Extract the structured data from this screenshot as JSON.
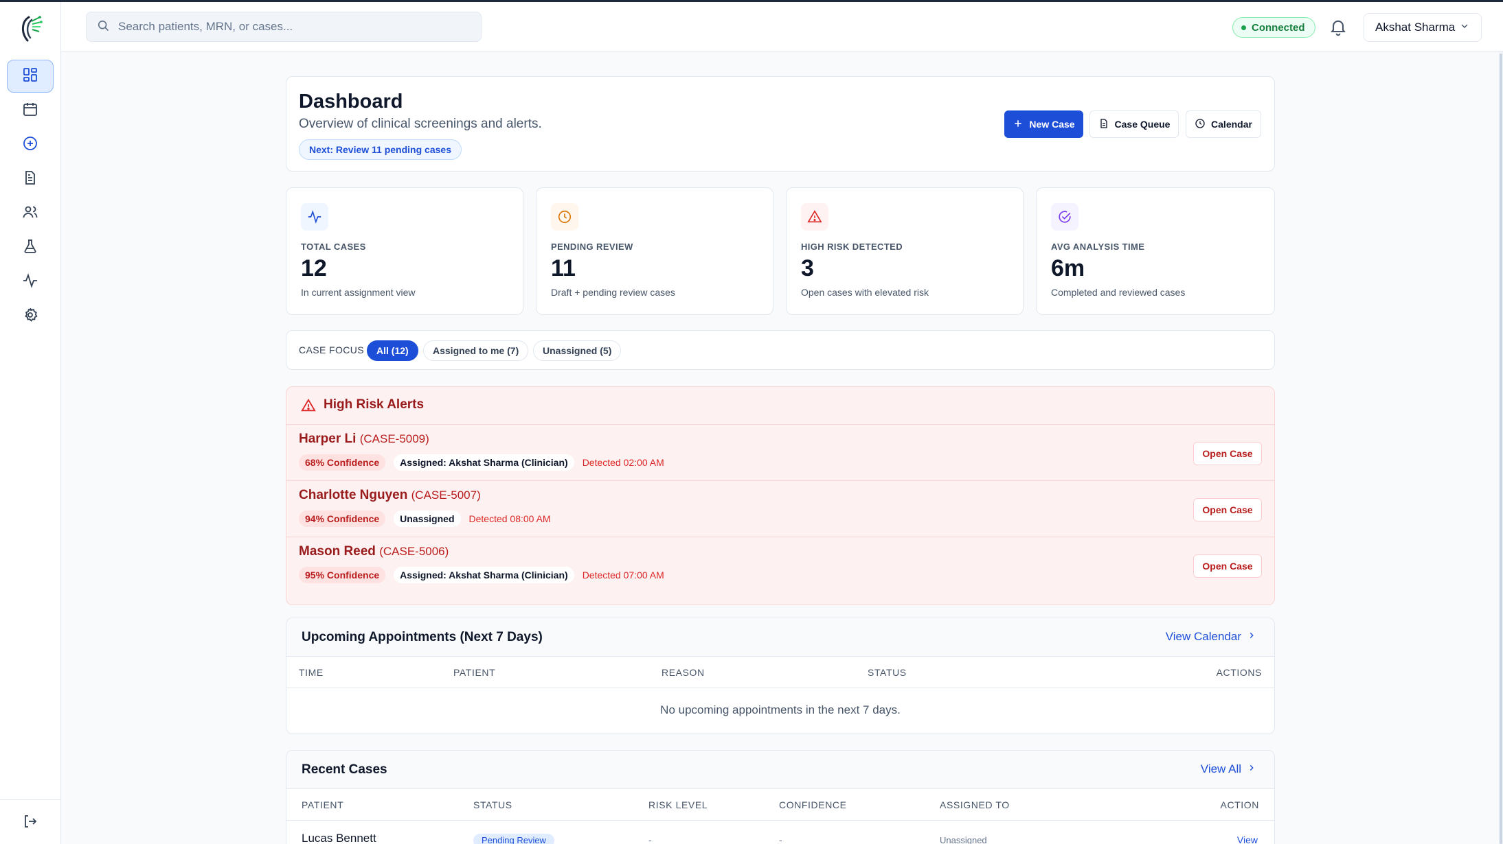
{
  "header": {
    "search_placeholder": "Search patients, MRN, or cases...",
    "connection_status": "Connected",
    "user_name": "Akshat Sharma"
  },
  "sidebar": {
    "items": [
      {
        "icon": "dashboard-icon",
        "active": true
      },
      {
        "icon": "calendar-icon",
        "active": false
      },
      {
        "icon": "plus-circle-icon",
        "active": false
      },
      {
        "icon": "document-icon",
        "active": false
      },
      {
        "icon": "users-icon",
        "active": false
      },
      {
        "icon": "flask-icon",
        "active": false
      },
      {
        "icon": "activity-icon",
        "active": false
      },
      {
        "icon": "settings-icon",
        "active": false
      }
    ],
    "logout_icon": "logout-icon"
  },
  "dashboard": {
    "title": "Dashboard",
    "subtitle": "Overview of clinical screenings and alerts.",
    "next_action": "Next: Review 11 pending cases",
    "buttons": {
      "new_case": "New Case",
      "case_queue": "Case Queue",
      "calendar": "Calendar"
    }
  },
  "stats": [
    {
      "label": "TOTAL CASES",
      "value": "12",
      "desc": "In current assignment view",
      "icon": "activity-icon",
      "color": "#1d4ed8"
    },
    {
      "label": "PENDING REVIEW",
      "value": "11",
      "desc": "Draft + pending review cases",
      "icon": "clock-icon",
      "color": "#d97706"
    },
    {
      "label": "HIGH RISK DETECTED",
      "value": "3",
      "desc": "Open cases with elevated risk",
      "icon": "alert-triangle-icon",
      "color": "#dc2626"
    },
    {
      "label": "AVG ANALYSIS TIME",
      "value": "6m",
      "desc": "Completed and reviewed cases",
      "icon": "check-circle-icon",
      "color": "#7c3aed"
    }
  ],
  "case_focus": {
    "label": "CASE FOCUS",
    "chips": [
      {
        "label": "All (12)",
        "active": true
      },
      {
        "label": "Assigned to me (7)",
        "active": false
      },
      {
        "label": "Unassigned (5)",
        "active": false
      }
    ]
  },
  "alerts": {
    "title": "High Risk Alerts",
    "open_label": "Open Case",
    "rows": [
      {
        "name": "Harper Li",
        "case_id": "(CASE-5009)",
        "confidence": "68% Confidence",
        "assigned": "Assigned: Akshat Sharma (Clinician)",
        "detected": "Detected 02:00 AM"
      },
      {
        "name": "Charlotte Nguyen",
        "case_id": "(CASE-5007)",
        "confidence": "94% Confidence",
        "assigned": "Unassigned",
        "detected": "Detected 08:00 AM"
      },
      {
        "name": "Mason Reed",
        "case_id": "(CASE-5006)",
        "confidence": "95% Confidence",
        "assigned": "Assigned: Akshat Sharma (Clinician)",
        "detected": "Detected 07:00 AM"
      }
    ]
  },
  "appointments": {
    "title": "Upcoming Appointments (Next 7 Days)",
    "link": "View Calendar",
    "columns": [
      "TIME",
      "PATIENT",
      "REASON",
      "STATUS",
      "ACTIONS"
    ],
    "empty": "No upcoming appointments in the next 7 days."
  },
  "recent_cases": {
    "title": "Recent Cases",
    "link": "View All",
    "columns": [
      "PATIENT",
      "STATUS",
      "RISK LEVEL",
      "CONFIDENCE",
      "ASSIGNED TO",
      "ACTION"
    ],
    "rows": [
      {
        "patient": "Lucas Bennett",
        "status": "Pending Review",
        "risk": "-",
        "confidence": "-",
        "assigned": "Unassigned",
        "action": "View"
      }
    ]
  }
}
